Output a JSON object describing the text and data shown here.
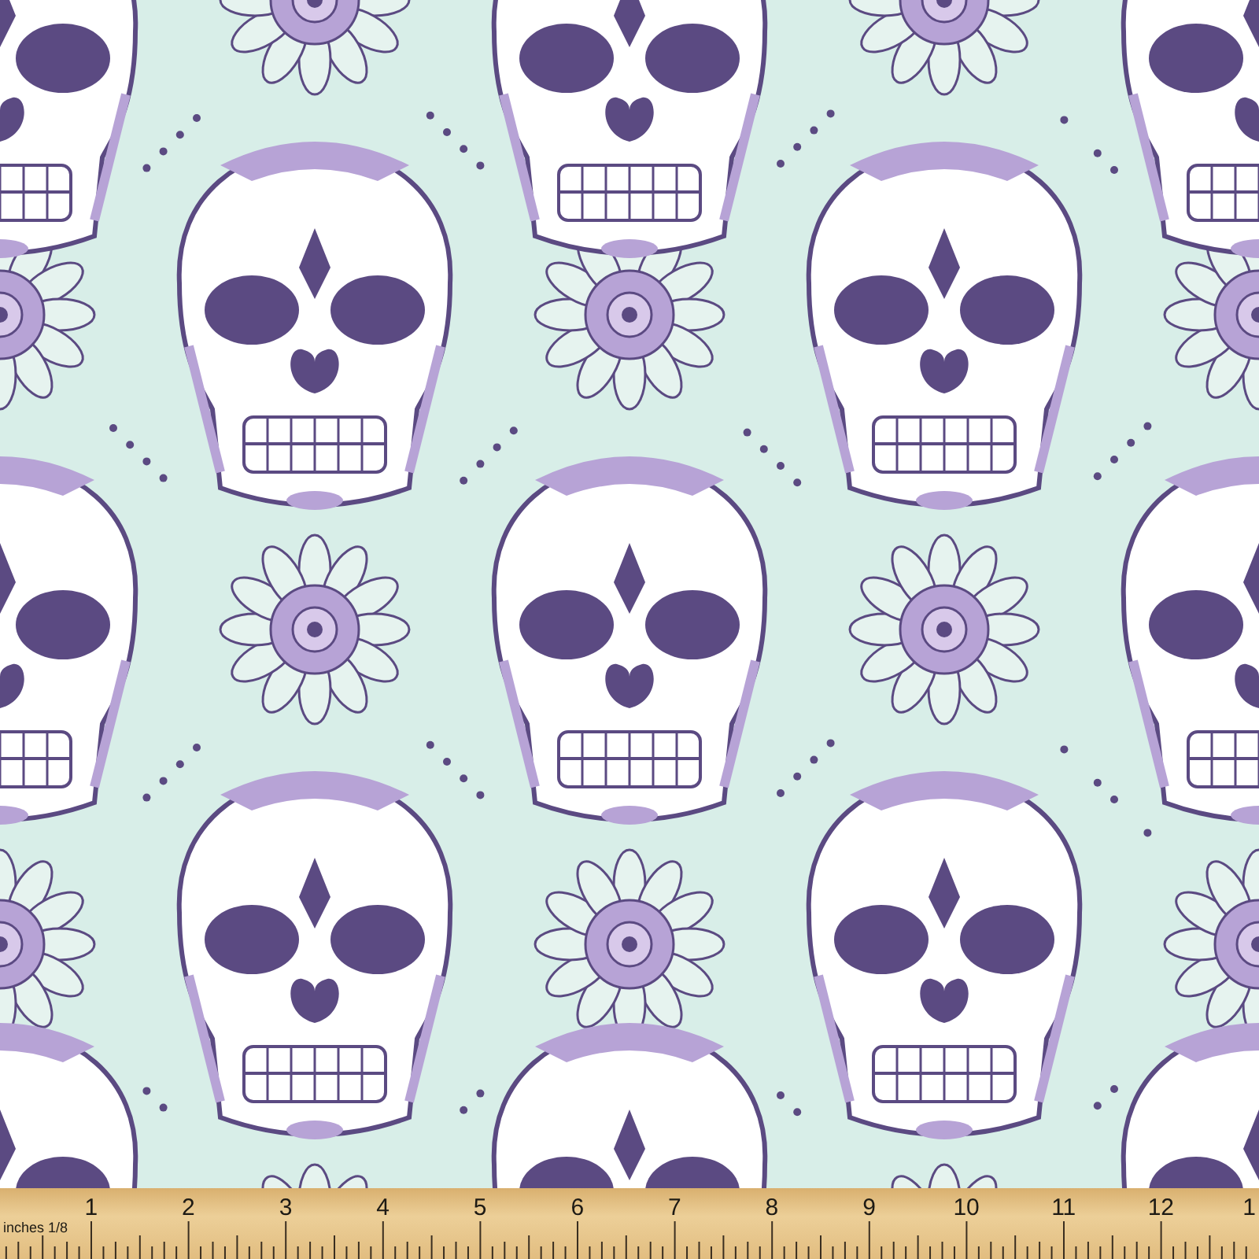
{
  "ruler": {
    "unit_label": "inches 1/8",
    "numbers": [
      "1",
      "2",
      "3",
      "4",
      "5",
      "6",
      "7",
      "8",
      "9",
      "10",
      "11",
      "12",
      "1"
    ]
  }
}
